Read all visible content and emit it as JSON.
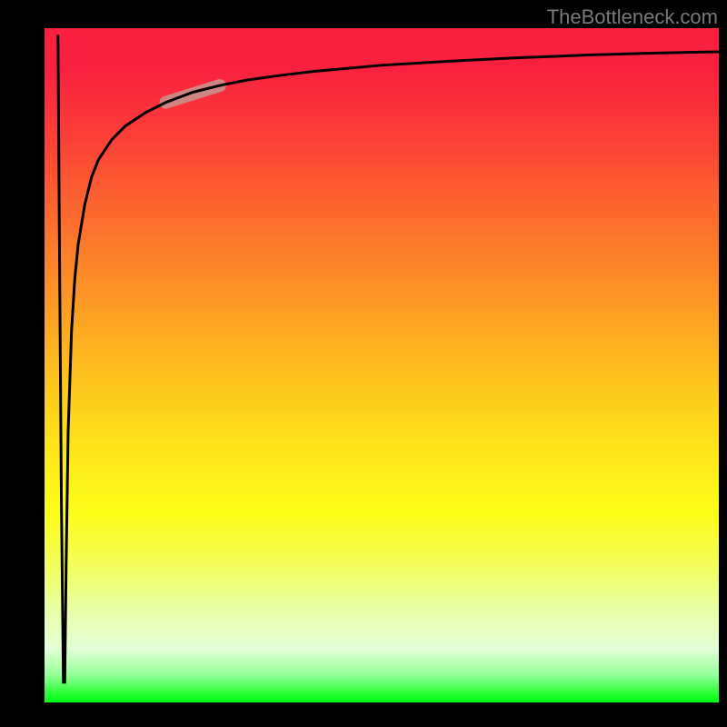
{
  "watermark": "TheBottleneck.com",
  "colors": {
    "gradient_top": "#f9213e",
    "gradient_mid": "#fee41a",
    "gradient_bottom": "#00ff18",
    "curve": "#000000",
    "highlight": "#cb8e8a",
    "frame": "#000000"
  },
  "chart_data": {
    "type": "line",
    "title": "",
    "xlabel": "",
    "ylabel": "",
    "xlim": [
      0,
      100
    ],
    "ylim": [
      0,
      100
    ],
    "series": [
      {
        "name": "main-curve",
        "x": [
          2.0,
          2.2,
          2.5,
          2.8,
          3.0,
          3.2,
          3.5,
          4.0,
          4.5,
          5.0,
          6.0,
          7.0,
          8.0,
          10.0,
          12.0,
          15.0,
          18.0,
          22.0,
          26.0,
          30.0,
          35.0,
          40.0,
          50.0,
          60.0,
          70.0,
          80.0,
          90.0,
          100.0
        ],
        "y": [
          99,
          70,
          30,
          3,
          3,
          20,
          40,
          55,
          63,
          68,
          74,
          78,
          80.5,
          83.5,
          85.5,
          87.5,
          89,
          90.5,
          91.5,
          92.3,
          93,
          93.6,
          94.5,
          95.1,
          95.6,
          96,
          96.3,
          96.5
        ]
      },
      {
        "name": "highlight-segment",
        "x": [
          18,
          26
        ],
        "y": [
          89,
          91.5
        ]
      }
    ],
    "annotations": []
  }
}
